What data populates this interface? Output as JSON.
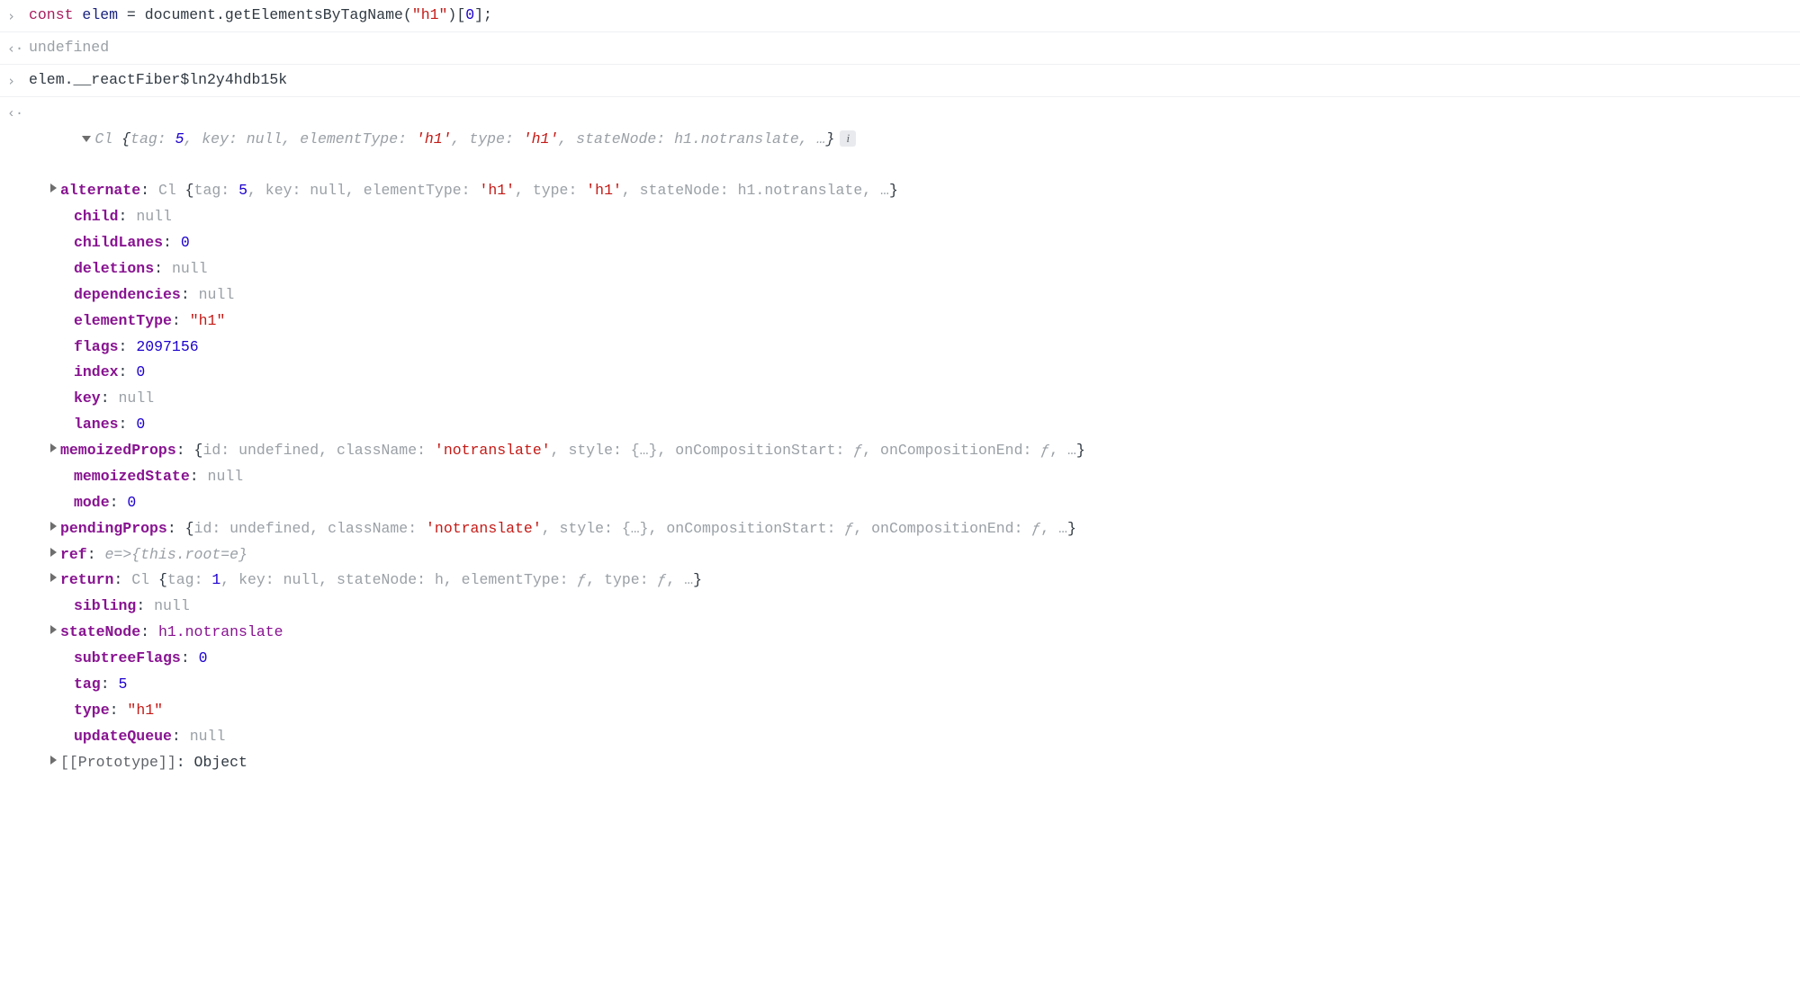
{
  "rows": {
    "input1_kw": "const",
    "input1_var": "elem",
    "input1_eq": " = ",
    "input1_obj": "document.getElementsByTagName",
    "input1_paren": "(",
    "input1_str": "\"h1\"",
    "input1_close": ")[",
    "input1_idx": "0",
    "input1_end": "];",
    "output1": "undefined",
    "input2": "elem.__reactFiber$ln2y4hdb15k"
  },
  "summary": {
    "cl": "Cl ",
    "open": "{",
    "seg_tag_k": "tag: ",
    "seg_tag_v": "5",
    "seg_key_k": ", key: ",
    "seg_key_v": "null",
    "seg_et_k": ", elementType: ",
    "seg_et_v": "'h1'",
    "seg_type_k": ", type: ",
    "seg_type_v": "'h1'",
    "seg_sn_k": ", stateNode: ",
    "seg_sn_v": "h1.notranslate",
    "ell": ", …",
    "close": "}"
  },
  "props": {
    "alternate_k": "alternate",
    "alternate_v": "Cl {tag: 5, key: null, elementType: 'h1', type: 'h1', stateNode: h1.notranslate, …}",
    "child_k": "child",
    "child_v": "null",
    "childLanes_k": "childLanes",
    "childLanes_v": "0",
    "deletions_k": "deletions",
    "deletions_v": "null",
    "dependencies_k": "dependencies",
    "dependencies_v": "null",
    "elementType_k": "elementType",
    "elementType_v": "\"h1\"",
    "flags_k": "flags",
    "flags_v": "2097156",
    "index_k": "index",
    "index_v": "0",
    "key_k": "key",
    "key_v": "null",
    "lanes_k": "lanes",
    "lanes_v": "0",
    "memoizedProps_k": "memoizedProps",
    "memoizedState_k": "memoizedState",
    "memoizedState_v": "null",
    "mode_k": "mode",
    "mode_v": "0",
    "pendingProps_k": "pendingProps",
    "ref_k": "ref",
    "ref_v": "e=>{this.root=e}",
    "return_k": "return",
    "sibling_k": "sibling",
    "sibling_v": "null",
    "stateNode_k": "stateNode",
    "stateNode_v": "h1.notranslate",
    "subtreeFlags_k": "subtreeFlags",
    "subtreeFlags_v": "0",
    "tag_k": "tag",
    "tag_v": "5",
    "type_k": "type",
    "type_v": "\"h1\"",
    "updateQueue_k": "updateQueue",
    "updateQueue_v": "null",
    "proto_k": "[[Prototype]]",
    "proto_v": "Object"
  },
  "propsObj": {
    "open": "{",
    "id_k": "id: ",
    "id_v": "undefined",
    "cn_k": ", className: ",
    "cn_v": "'notranslate'",
    "st_k": ", style: ",
    "st_v": "{…}",
    "ocs_k": ", onCompositionStart: ",
    "ocs_v": "ƒ",
    "oce_k": ", onCompositionEnd: ",
    "oce_v": "ƒ",
    "ell": ", …",
    "close": "}"
  },
  "returnObj": {
    "pre": "Cl ",
    "open": "{",
    "tag_k": "tag: ",
    "tag_v": "1",
    "key_k": ", key: ",
    "key_v": "null",
    "sn_k": ", stateNode: ",
    "sn_v": "h",
    "et_k": ", elementType: ",
    "et_v": "ƒ",
    "ty_k": ", type: ",
    "ty_v": "ƒ",
    "ell": ", …",
    "close": "}"
  },
  "glyphs": {
    "prompt_in": "›",
    "prompt_out": "‹·"
  }
}
